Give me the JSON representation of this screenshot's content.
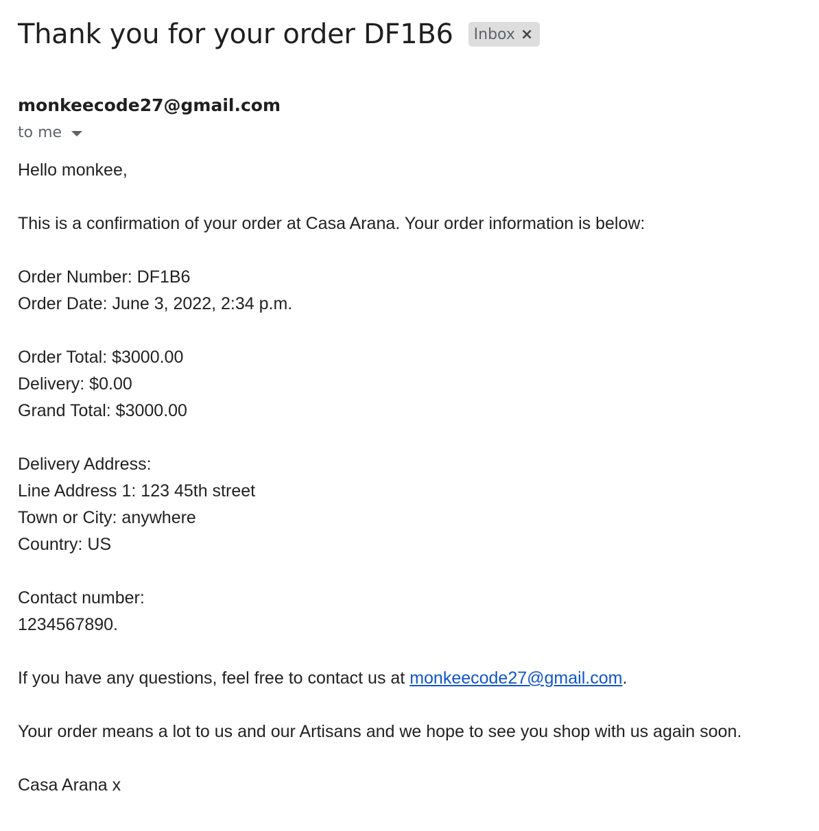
{
  "email": {
    "subject": "Thank you for your order DF1B6",
    "label": "Inbox",
    "label_close": "×",
    "sender": "monkeecode27@gmail.com",
    "recipient": "to me"
  },
  "body": {
    "greeting": "Hello monkee,",
    "intro": "This is a confirmation of your order at Casa Arana. Your order information is below:",
    "order_number": "Order Number: DF1B6",
    "order_date": "Order Date: June 3, 2022, 2:34 p.m.",
    "order_total": "Order Total: $3000.00",
    "delivery": "Delivery: $0.00",
    "grand_total": "Grand Total: $3000.00",
    "delivery_address_heading": "Delivery Address:",
    "line_address_1": "Line Address 1: 123 45th street",
    "town_or_city": "Town or City: anywhere",
    "country": "Country: US",
    "contact_heading": "Contact number:",
    "contact_number": "1234567890.",
    "questions_prefix": "If you have any questions, feel free to contact us at ",
    "questions_link": "monkeecode27@gmail.com",
    "questions_suffix": ".",
    "closing": "Your order means a lot to us and our Artisans and we hope to see you shop with us again soon.",
    "signature": "Casa Arana x"
  }
}
